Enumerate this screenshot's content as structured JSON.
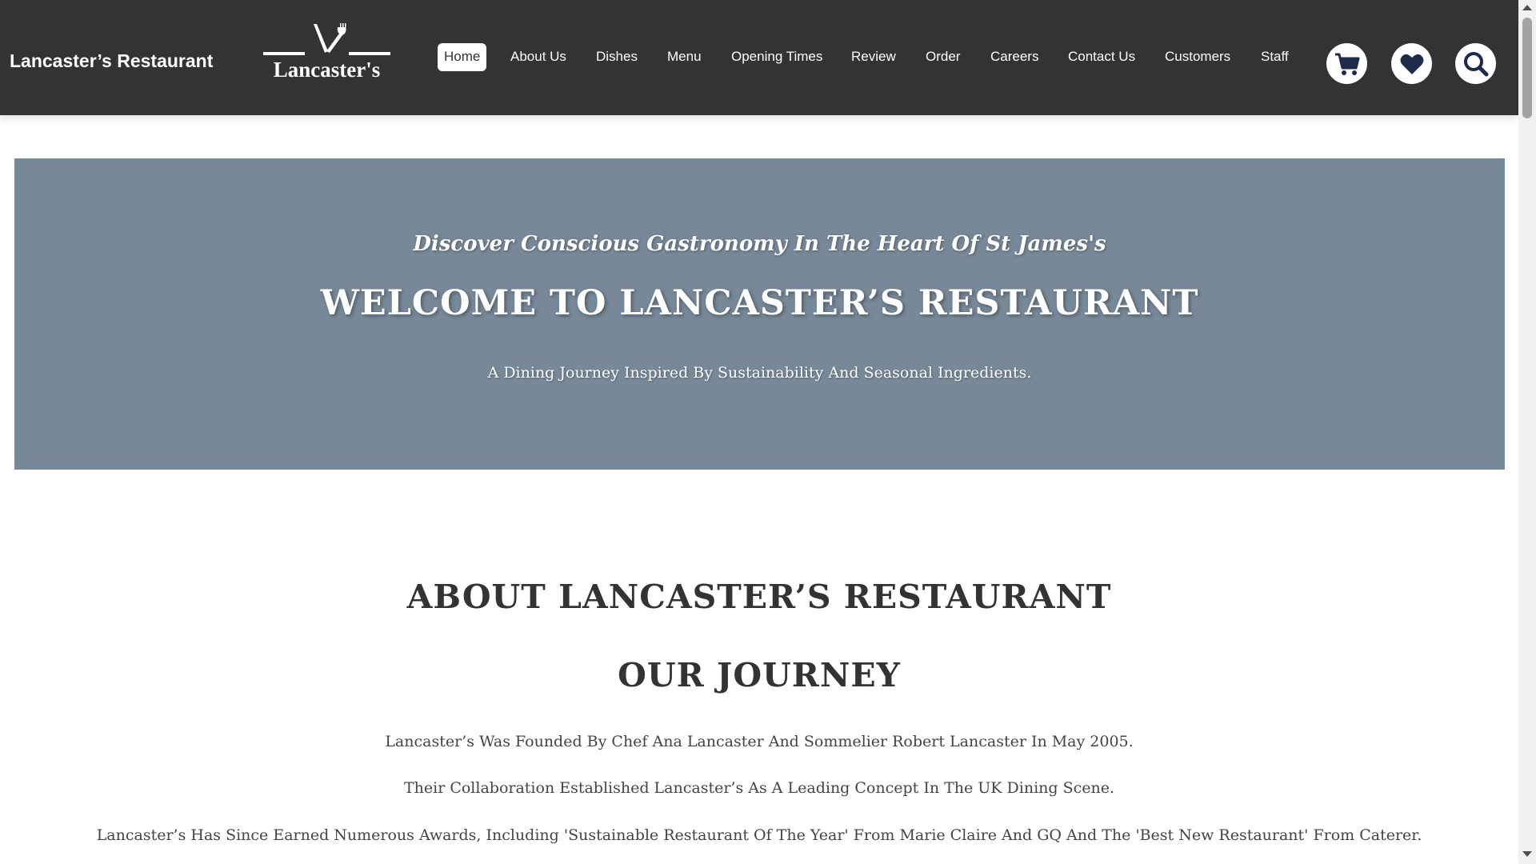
{
  "header": {
    "brand": "Lancaster’s Restaurant",
    "logo_text": "Lancaster's",
    "logo_icon": "fork-knife-icon",
    "background_color": "#333333"
  },
  "nav": {
    "items": [
      {
        "label": "Home",
        "active": true
      },
      {
        "label": "About Us"
      },
      {
        "label": "Dishes"
      },
      {
        "label": "Menu"
      },
      {
        "label": "Opening Times"
      },
      {
        "label": "Review"
      },
      {
        "label": "Order"
      },
      {
        "label": "Careers"
      },
      {
        "label": "Contact Us"
      },
      {
        "label": "Customers"
      },
      {
        "label": "Staff"
      }
    ]
  },
  "actions": {
    "cart_icon": "cart-icon",
    "favorites_icon": "heart-icon",
    "search_icon": "search-icon",
    "icon_color": "#1e2a4a"
  },
  "hero": {
    "subtitle": "Discover Conscious Gastronomy In The Heart Of St James's",
    "title": "WELCOME TO LANCASTER’S RESTAURANT",
    "description": "A Dining Journey Inspired By Sustainability And Seasonal Ingredients.",
    "background_color": "#778899"
  },
  "about": {
    "title": "ABOUT LANCASTER’S RESTAURANT",
    "subtitle": "OUR JOURNEY",
    "paragraphs": [
      "Lancaster’s Was Founded By Chef Ana Lancaster And Sommelier Robert Lancaster In May 2005.",
      "Their Collaboration Established Lancaster’s As A Leading Concept In The UK Dining Scene.",
      "Lancaster’s Has Since Earned Numerous Awards, Including 'Sustainable Restaurant Of The Year' From Marie Claire And GQ And The 'Best New Restaurant' From Caterer."
    ]
  }
}
